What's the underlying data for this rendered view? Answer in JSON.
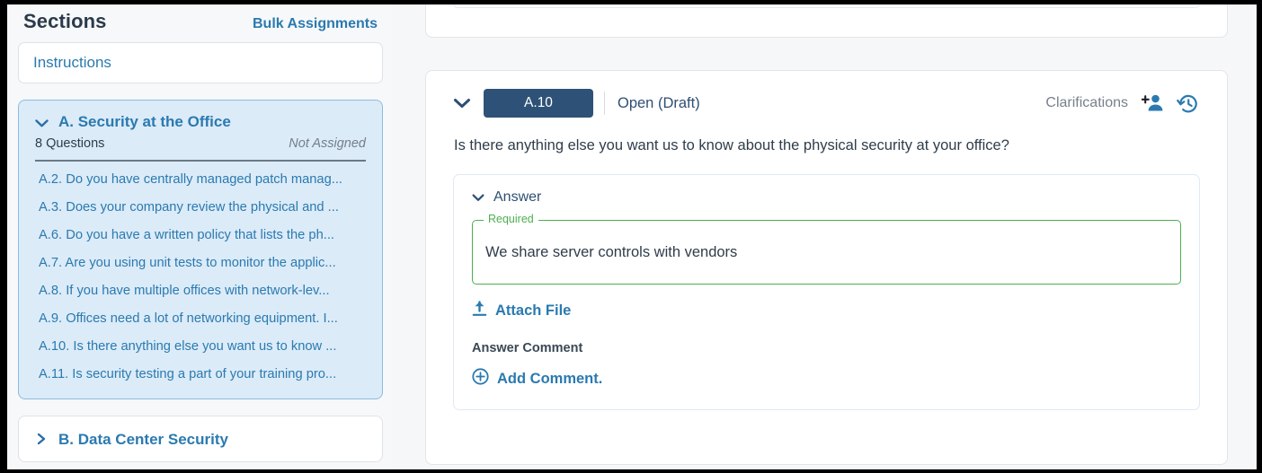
{
  "sidebar": {
    "title": "Sections",
    "bulk_assignments_label": "Bulk Assignments",
    "instructions_label": "Instructions",
    "sections": [
      {
        "name": "A. Security at the Office",
        "question_count_label": "8 Questions",
        "assignment_status": "Not Assigned",
        "expanded": true,
        "questions": [
          "A.2. Do you have centrally managed patch manag...",
          "A.3. Does your company review the physical and ...",
          "A.6. Do you have a written policy that lists the ph...",
          "A.7. Are you using unit tests to monitor the applic...",
          "A.8. If you have multiple offices with network-lev...",
          "A.9. Offices need a lot of networking equipment. I...",
          "A.10. Is there anything else you want us to know ...",
          "A.11. Is security testing a part of your training pro..."
        ]
      },
      {
        "name": "B. Data Center Security",
        "expanded": false,
        "questions": []
      }
    ]
  },
  "main": {
    "question": {
      "id_badge": "A.10",
      "status": "Open (Draft)",
      "clarifications_label": "Clarifications",
      "text": "Is there anything else you want us to know about the physical security at your office?",
      "answer_section": {
        "label": "Answer",
        "field_legend": "Required",
        "field_value": "We share server controls with vendors",
        "attach_file_label": "Attach File",
        "answer_comment_label": "Answer Comment",
        "add_comment_label": "Add Comment."
      }
    }
  },
  "icons": {
    "chevron_down": "⌄",
    "chevron_right": "›"
  },
  "colors": {
    "link_blue": "#2a7ab0",
    "badge_navy": "#2e5277",
    "required_green": "#4caf50",
    "section_highlight_bg": "#dcebf8",
    "canvas_bg": "#f6f7f8"
  }
}
